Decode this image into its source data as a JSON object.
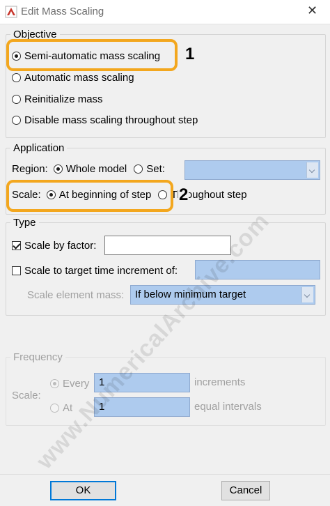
{
  "window": {
    "title": "Edit Mass Scaling"
  },
  "objective": {
    "legend": "Objective",
    "options": [
      "Semi-automatic mass scaling",
      "Automatic mass scaling",
      "Reinitialize mass",
      "Disable mass scaling throughout step"
    ],
    "selected": 0
  },
  "application": {
    "legend": "Application",
    "region_label": "Region:",
    "region_whole_model": "Whole model",
    "region_set": "Set:",
    "scale_label": "Scale:",
    "scale_beginning": "At beginning of step",
    "scale_throughout": "Throughout step"
  },
  "type": {
    "legend": "Type",
    "scale_by_factor": "Scale by factor:",
    "scale_by_factor_checked": true,
    "scale_by_factor_value": "",
    "scale_to_target": "Scale to target time increment of:",
    "scale_to_target_checked": false,
    "scale_to_target_value": "",
    "scale_element_mass_label": "Scale element mass:",
    "scale_element_mass_value": "If below minimum target"
  },
  "frequency": {
    "legend": "Frequency",
    "scale_label": "Scale:",
    "every_label": "Every",
    "every_value": "1",
    "every_suffix": "increments",
    "at_label": "At",
    "at_value": "1",
    "at_suffix": "equal intervals"
  },
  "buttons": {
    "ok": "OK",
    "cancel": "Cancel"
  },
  "annotations": {
    "callout_1": "1",
    "callout_2": "2"
  },
  "watermark": "www.NumericalArchive.com",
  "colors": {
    "callout": "#f3a71e",
    "field_blue": "#aecbee"
  }
}
